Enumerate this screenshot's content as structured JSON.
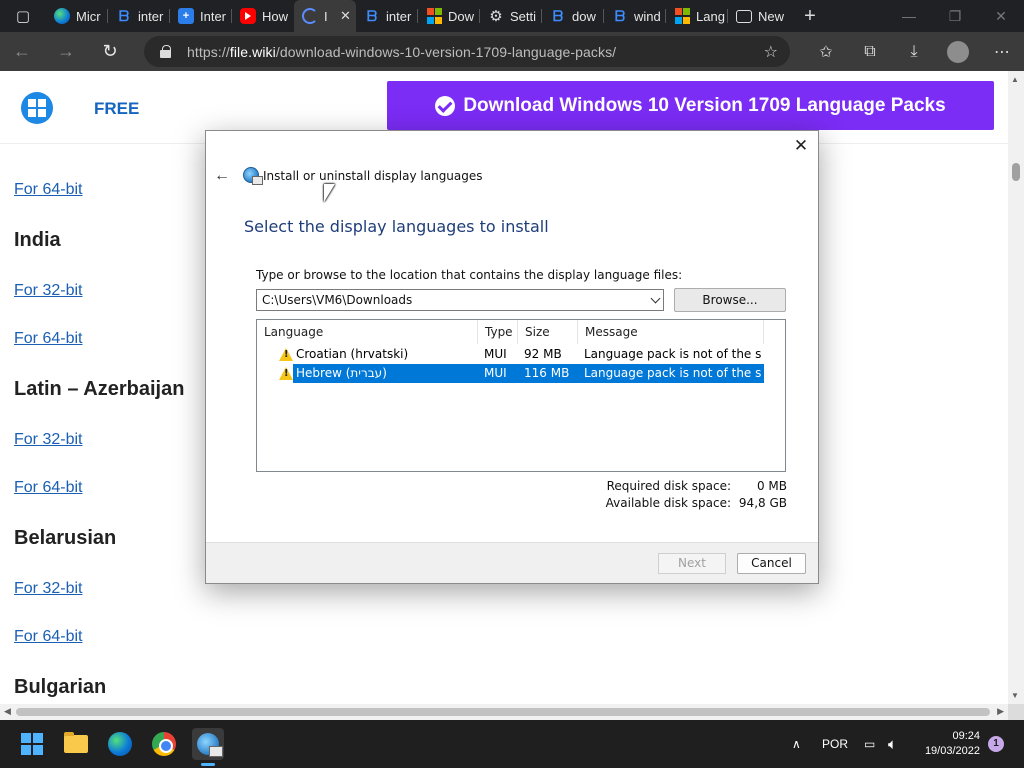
{
  "browser": {
    "tabs": [
      {
        "label": "Micr",
        "icon": "edge-icon"
      },
      {
        "label": "inter",
        "icon": "bing-icon"
      },
      {
        "label": "Inter",
        "icon": "plus-app-icon"
      },
      {
        "label": "How",
        "icon": "youtube-icon"
      },
      {
        "label": "I",
        "icon": "loading-icon",
        "active": true
      },
      {
        "label": "inter",
        "icon": "bing-icon"
      },
      {
        "label": "Dow",
        "icon": "microsoft-icon"
      },
      {
        "label": "Setti",
        "icon": "gear-icon"
      },
      {
        "label": "dow",
        "icon": "bing-icon"
      },
      {
        "label": "wind",
        "icon": "bing-icon"
      },
      {
        "label": "Lang",
        "icon": "microsoft-icon"
      },
      {
        "label": "New",
        "icon": "new-tab-page-icon"
      }
    ],
    "url_scheme": "https://",
    "url_host": "file.wiki",
    "url_path": "/download-windows-10-version-1709-language-packs/"
  },
  "page": {
    "free_label": "FREE",
    "banner_text": "Download Windows 10 Version 1709 Language Packs",
    "links": [
      {
        "type": "link",
        "text": "For 64-bit"
      },
      {
        "type": "heading",
        "text": "India"
      },
      {
        "type": "link",
        "text": "For 32-bit"
      },
      {
        "type": "link",
        "text": "For 64-bit"
      },
      {
        "type": "heading",
        "text": "Latin – Azerbaijan"
      },
      {
        "type": "link",
        "text": "For 32-bit"
      },
      {
        "type": "link",
        "text": "For 64-bit"
      },
      {
        "type": "heading",
        "text": "Belarusian"
      },
      {
        "type": "link",
        "text": "For 32-bit"
      },
      {
        "type": "link",
        "text": "For 64-bit"
      },
      {
        "type": "heading",
        "text": "Bulgarian"
      }
    ]
  },
  "dialog": {
    "title": "Install or uninstall display languages",
    "heading": "Select the display languages to install",
    "prompt": "Type or browse to the location that contains the display language files:",
    "path_value": "C:\\Users\\VM6\\Downloads",
    "browse_label": "Browse...",
    "columns": [
      "Language",
      "Type",
      "Size",
      "Message"
    ],
    "rows": [
      {
        "language": "Croatian (hrvatski)",
        "type": "MUI",
        "size": "92 MB",
        "message": "Language pack is not of the sa...",
        "selected": false
      },
      {
        "language": "Hebrew (עברית)",
        "type": "MUI",
        "size": "116 MB",
        "message": "Language pack is not of the sa...",
        "selected": true
      }
    ],
    "required_label": "Required disk space:",
    "required_value": "0 MB",
    "available_label": "Available disk space:",
    "available_value": "94,8 GB",
    "next_label": "Next",
    "cancel_label": "Cancel"
  },
  "taskbar": {
    "language": "POR",
    "time": "09:24",
    "date": "19/03/2022",
    "notifications": "1"
  },
  "colors": {
    "banner": "#7b2cf5",
    "selection": "#0078d7",
    "link": "#1a5fb4"
  }
}
